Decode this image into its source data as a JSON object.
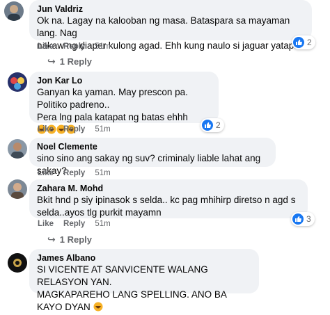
{
  "comments": [
    {
      "author": "Jun Valdriz",
      "text": "Ok na. Lagay na kalooban ng masa. Bataspara sa mayaman lang. Nag\nnakaw ng diaper kulong agad. Ehh kung naulo si jaguar yatap.",
      "like": "Like",
      "reply": "Reply",
      "time": "51m",
      "reactions": "2",
      "replies_link": "1 Reply"
    },
    {
      "author": "Jon Kar Lo",
      "line1": "Ganyan ka yaman. May prescon pa.",
      "line2": "Politiko padreno..",
      "line3": "Pera lng pala katapat ng batas ehhh",
      "like": "Like",
      "reply": "Reply",
      "time": "51m",
      "reactions": "2"
    },
    {
      "author": "Noel Clemente",
      "text": "sino sino ang sakay ng suv? criminaly liable lahat ang sakay?",
      "like": "Like",
      "reply": "Reply",
      "time": "51m"
    },
    {
      "author": "Zahara M. Mohd",
      "text": "Bkit hnd p siy ipinasok s selda.. kc pag mhihirp diretso n agd s\nselda..ayos tlg purkit mayamn",
      "like": "Like",
      "reply": "Reply",
      "time": "51m",
      "reactions": "3",
      "replies_link": "1 Reply"
    },
    {
      "author": "James Albano",
      "line1": "SI VICENTE AT SANVICENTE WALANG RELASYON YAN.",
      "line2": "MAGKAPAREHO LANG SPELLING. ANO BA KAYO DYAN"
    }
  ],
  "icons": {
    "like": "like-icon",
    "laugh": "laughing-emoji-icon",
    "reply_arrow": "reply-arrow-icon"
  },
  "colors": {
    "accent": "#1877f2",
    "bubble": "#f0f2f5",
    "meta_text": "#65676b",
    "emoji": "#f7b125"
  }
}
